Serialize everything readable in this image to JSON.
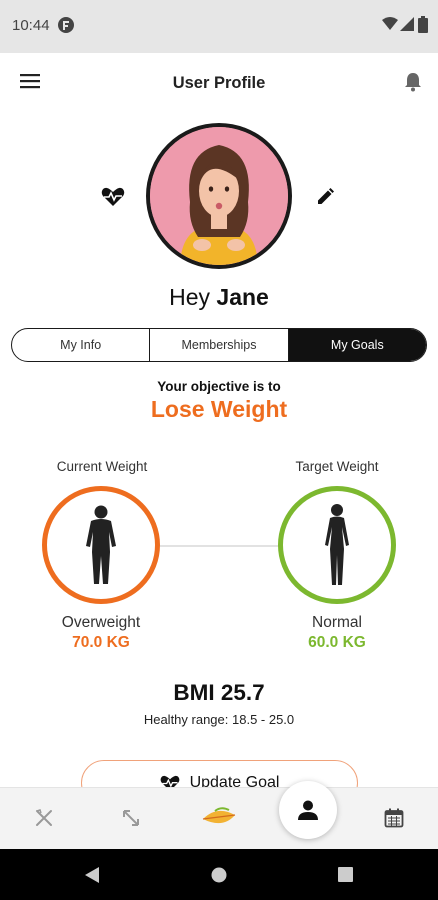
{
  "status_bar": {
    "time": "10:44"
  },
  "app_bar": {
    "title": "User Profile"
  },
  "profile": {
    "greeting_prefix": "Hey",
    "name": "Jane"
  },
  "tabs": [
    {
      "label": "My Info",
      "active": false
    },
    {
      "label": "Memberships",
      "active": false
    },
    {
      "label": "My Goals",
      "active": true
    }
  ],
  "objective": {
    "intro": "Your objective is to",
    "goal": "Lose Weight"
  },
  "current": {
    "label": "Current Weight",
    "status": "Overweight",
    "value": "70.0 KG",
    "color": "#ee6d1f"
  },
  "target": {
    "label": "Target Weight",
    "status": "Normal",
    "value": "60.0 KG",
    "color": "#7cb82f"
  },
  "bmi": {
    "text": "BMI 25.7",
    "healthy_range": "Healthy range: 18.5 - 25.0"
  },
  "update_button": {
    "label": "Update Goal"
  },
  "bottom_nav": [
    "utensils-icon",
    "expand-icon",
    "leaf-icon",
    "profile-icon",
    "calendar-icon"
  ],
  "colors": {
    "accent": "#ee6d1f",
    "success": "#7cb82f",
    "dark": "#1a1a1a"
  }
}
